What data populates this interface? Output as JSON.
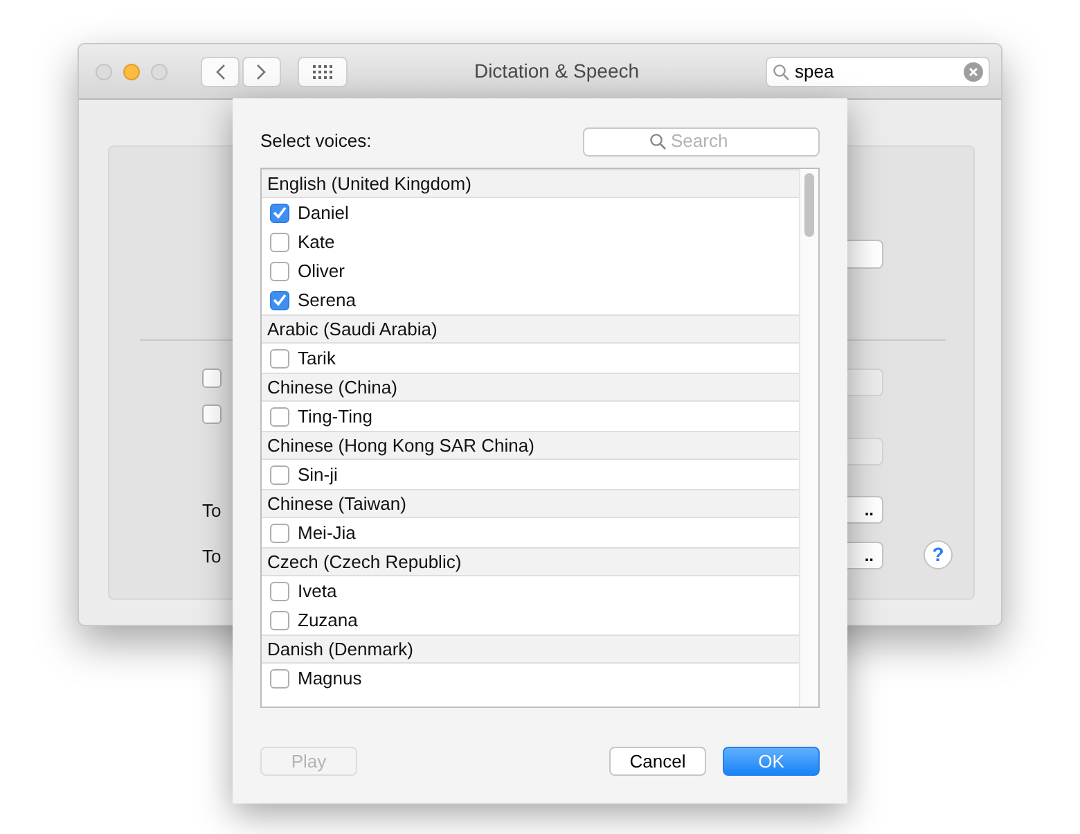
{
  "window": {
    "title": "Dictation & Speech",
    "search_value": "spea"
  },
  "background": {
    "checkboxes": [
      {
        "checked": false
      },
      {
        "checked": false
      }
    ],
    "rows": [
      {
        "label": "To"
      },
      {
        "label": "To"
      }
    ],
    "buttons": [
      {
        "disabled": true
      },
      {
        "disabled": true
      },
      {
        "label": "..",
        "disabled": false
      },
      {
        "label": "..",
        "disabled": false
      }
    ],
    "help": "?"
  },
  "sheet": {
    "label": "Select voices:",
    "search_placeholder": "Search",
    "groups": [
      {
        "name": "English (United Kingdom)",
        "voices": [
          {
            "name": "Daniel",
            "checked": true
          },
          {
            "name": "Kate",
            "checked": false
          },
          {
            "name": "Oliver",
            "checked": false
          },
          {
            "name": "Serena",
            "checked": true
          }
        ]
      },
      {
        "name": "Arabic (Saudi Arabia)",
        "voices": [
          {
            "name": "Tarik",
            "checked": false
          }
        ]
      },
      {
        "name": "Chinese (China)",
        "voices": [
          {
            "name": "Ting-Ting",
            "checked": false
          }
        ]
      },
      {
        "name": "Chinese (Hong Kong SAR China)",
        "voices": [
          {
            "name": "Sin-ji",
            "checked": false
          }
        ]
      },
      {
        "name": "Chinese (Taiwan)",
        "voices": [
          {
            "name": "Mei-Jia",
            "checked": false
          }
        ]
      },
      {
        "name": "Czech (Czech Republic)",
        "voices": [
          {
            "name": "Iveta",
            "checked": false
          },
          {
            "name": "Zuzana",
            "checked": false
          }
        ]
      },
      {
        "name": "Danish (Denmark)",
        "voices": [
          {
            "name": "Magnus",
            "checked": false
          }
        ]
      }
    ],
    "buttons": [
      {
        "label": "Play",
        "kind": "disabled"
      },
      {
        "label": "Cancel",
        "kind": "normal"
      },
      {
        "label": "OK",
        "kind": "primary"
      }
    ]
  }
}
